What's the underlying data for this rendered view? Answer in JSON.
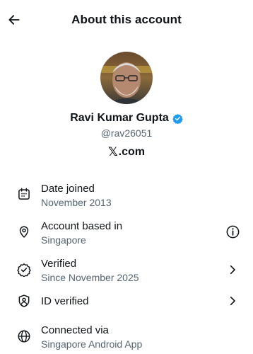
{
  "header": {
    "title": "About this account"
  },
  "profile": {
    "display_name": "Ravi Kumar Gupta",
    "handle": "@rav26051",
    "brand_mark": "𝕏",
    "brand_text": ".com",
    "verified_color": "#1d9bf0"
  },
  "rows": [
    {
      "icon": "calendar-icon",
      "title": "Date joined",
      "subtitle": "November 2013",
      "trailing": ""
    },
    {
      "icon": "location-pin-icon",
      "title": "Account based in",
      "subtitle": "Singapore",
      "trailing": "info-icon"
    },
    {
      "icon": "verified-seal-icon",
      "title": "Verified",
      "subtitle": "Since November 2025",
      "trailing": "chevron-right-icon"
    },
    {
      "icon": "shield-person-icon",
      "title": "ID verified",
      "subtitle": "",
      "trailing": "chevron-right-icon"
    },
    {
      "icon": "globe-icon",
      "title": "Connected via",
      "subtitle": "Singapore Android App",
      "trailing": ""
    }
  ],
  "colors": {
    "text_primary": "#0f1419",
    "text_secondary": "#536471"
  }
}
